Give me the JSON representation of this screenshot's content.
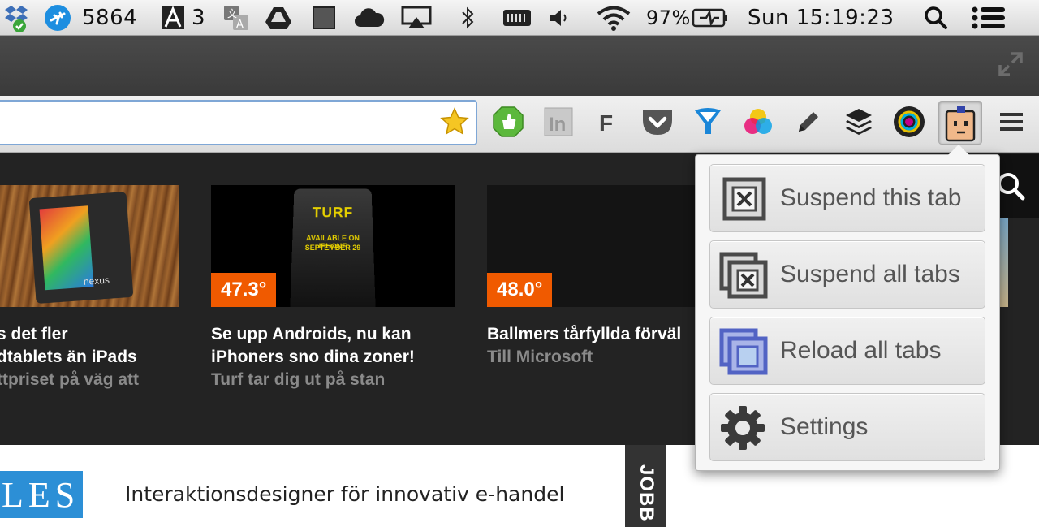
{
  "menubar": {
    "flight_count": "5864",
    "adobe_count": "3",
    "battery": "97%",
    "clock": "Sun 15:19:23"
  },
  "popup": {
    "suspend_tab": "Suspend this tab",
    "suspend_all": "Suspend all tabs",
    "reload_all": "Reload all tabs",
    "settings": "Settings"
  },
  "articles": [
    {
      "title1": "s det fler",
      "title2": "dtablets än iPads",
      "sub": "ttpriset på väg att"
    },
    {
      "temp": "47.3°",
      "title1": "Se upp Androids, nu kan",
      "title2": "iPhoners sno dina zoner!",
      "sub": "Turf tar dig ut på stan",
      "poster1": "AVAILABLE ON IPHONE",
      "poster2": "SEPTEMBER 29",
      "logo": "TURF",
      "device_label": "nexus"
    },
    {
      "temp": "48.0°",
      "title1": "Ballmers tårfyllda förväl",
      "sub": "Till Microsoft"
    }
  ],
  "ad": {
    "logo": "LES",
    "text": "Interaktionsdesigner för innovativ e-handel",
    "side": "JOBB"
  },
  "colors": {
    "accent": "#f05a00",
    "popup_bg": "#f6f6f6"
  }
}
